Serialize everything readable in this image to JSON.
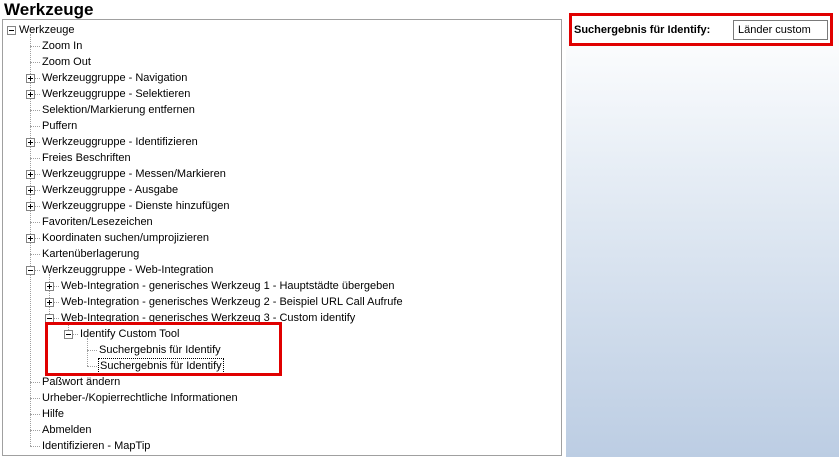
{
  "header": {
    "title": "Werkzeuge"
  },
  "tree": {
    "nodes": [
      {
        "label": "Werkzeuge",
        "depth": 0,
        "toggle": "minus",
        "selected": false
      },
      {
        "label": "Zoom In",
        "depth": 1,
        "toggle": "none",
        "selected": false
      },
      {
        "label": "Zoom Out",
        "depth": 1,
        "toggle": "none",
        "selected": false
      },
      {
        "label": "Werkzeuggruppe - Navigation",
        "depth": 1,
        "toggle": "plus",
        "selected": false
      },
      {
        "label": "Werkzeuggruppe - Selektieren",
        "depth": 1,
        "toggle": "plus",
        "selected": false
      },
      {
        "label": "Selektion/Markierung entfernen",
        "depth": 1,
        "toggle": "none",
        "selected": false
      },
      {
        "label": "Puffern",
        "depth": 1,
        "toggle": "none",
        "selected": false
      },
      {
        "label": "Werkzeuggruppe - Identifizieren",
        "depth": 1,
        "toggle": "plus",
        "selected": false
      },
      {
        "label": "Freies Beschriften",
        "depth": 1,
        "toggle": "none",
        "selected": false
      },
      {
        "label": "Werkzeuggruppe - Messen/Markieren",
        "depth": 1,
        "toggle": "plus",
        "selected": false
      },
      {
        "label": "Werkzeuggruppe - Ausgabe",
        "depth": 1,
        "toggle": "plus",
        "selected": false
      },
      {
        "label": "Werkzeuggruppe - Dienste hinzufügen",
        "depth": 1,
        "toggle": "plus",
        "selected": false
      },
      {
        "label": "Favoriten/Lesezeichen",
        "depth": 1,
        "toggle": "none",
        "selected": false
      },
      {
        "label": "Koordinaten suchen/umprojizieren",
        "depth": 1,
        "toggle": "plus",
        "selected": false
      },
      {
        "label": "Kartenüberlagerung",
        "depth": 1,
        "toggle": "none",
        "selected": false
      },
      {
        "label": "Werkzeuggruppe - Web-Integration",
        "depth": 1,
        "toggle": "minus",
        "selected": false
      },
      {
        "label": "Web-Integration - generisches Werkzeug 1 - Hauptstädte übergeben",
        "depth": 2,
        "toggle": "plus",
        "selected": false
      },
      {
        "label": "Web-Integration - generisches Werkzeug 2 - Beispiel URL Call Aufrufe",
        "depth": 2,
        "toggle": "plus",
        "selected": false
      },
      {
        "label": "Web-Integration - generisches Werkzeug 3 - Custom identify",
        "depth": 2,
        "toggle": "minus",
        "selected": false
      },
      {
        "label": "Identify Custom Tool",
        "depth": 3,
        "toggle": "minus",
        "selected": false
      },
      {
        "label": "Suchergebnis für Identify",
        "depth": 4,
        "toggle": "none",
        "selected": false
      },
      {
        "label": "Suchergebnis für Identify",
        "depth": 4,
        "toggle": "none",
        "selected": true
      },
      {
        "label": "Paßwort ändern",
        "depth": 1,
        "toggle": "none",
        "selected": false
      },
      {
        "label": "Urheber-/Kopierrechtliche Informationen",
        "depth": 1,
        "toggle": "none",
        "selected": false
      },
      {
        "label": "Hilfe",
        "depth": 1,
        "toggle": "none",
        "selected": false
      },
      {
        "label": "Abmelden",
        "depth": 1,
        "toggle": "none",
        "selected": false
      },
      {
        "label": "Identifizieren - MapTip",
        "depth": 1,
        "toggle": "none",
        "selected": false
      }
    ]
  },
  "properties": {
    "label": "Suchergebnis für Identify:",
    "value": "Länder custom"
  },
  "colors": {
    "highlight": "#e00000",
    "panel_gradient_end": "#bccde3",
    "tree_line": "#a0a0a0"
  }
}
